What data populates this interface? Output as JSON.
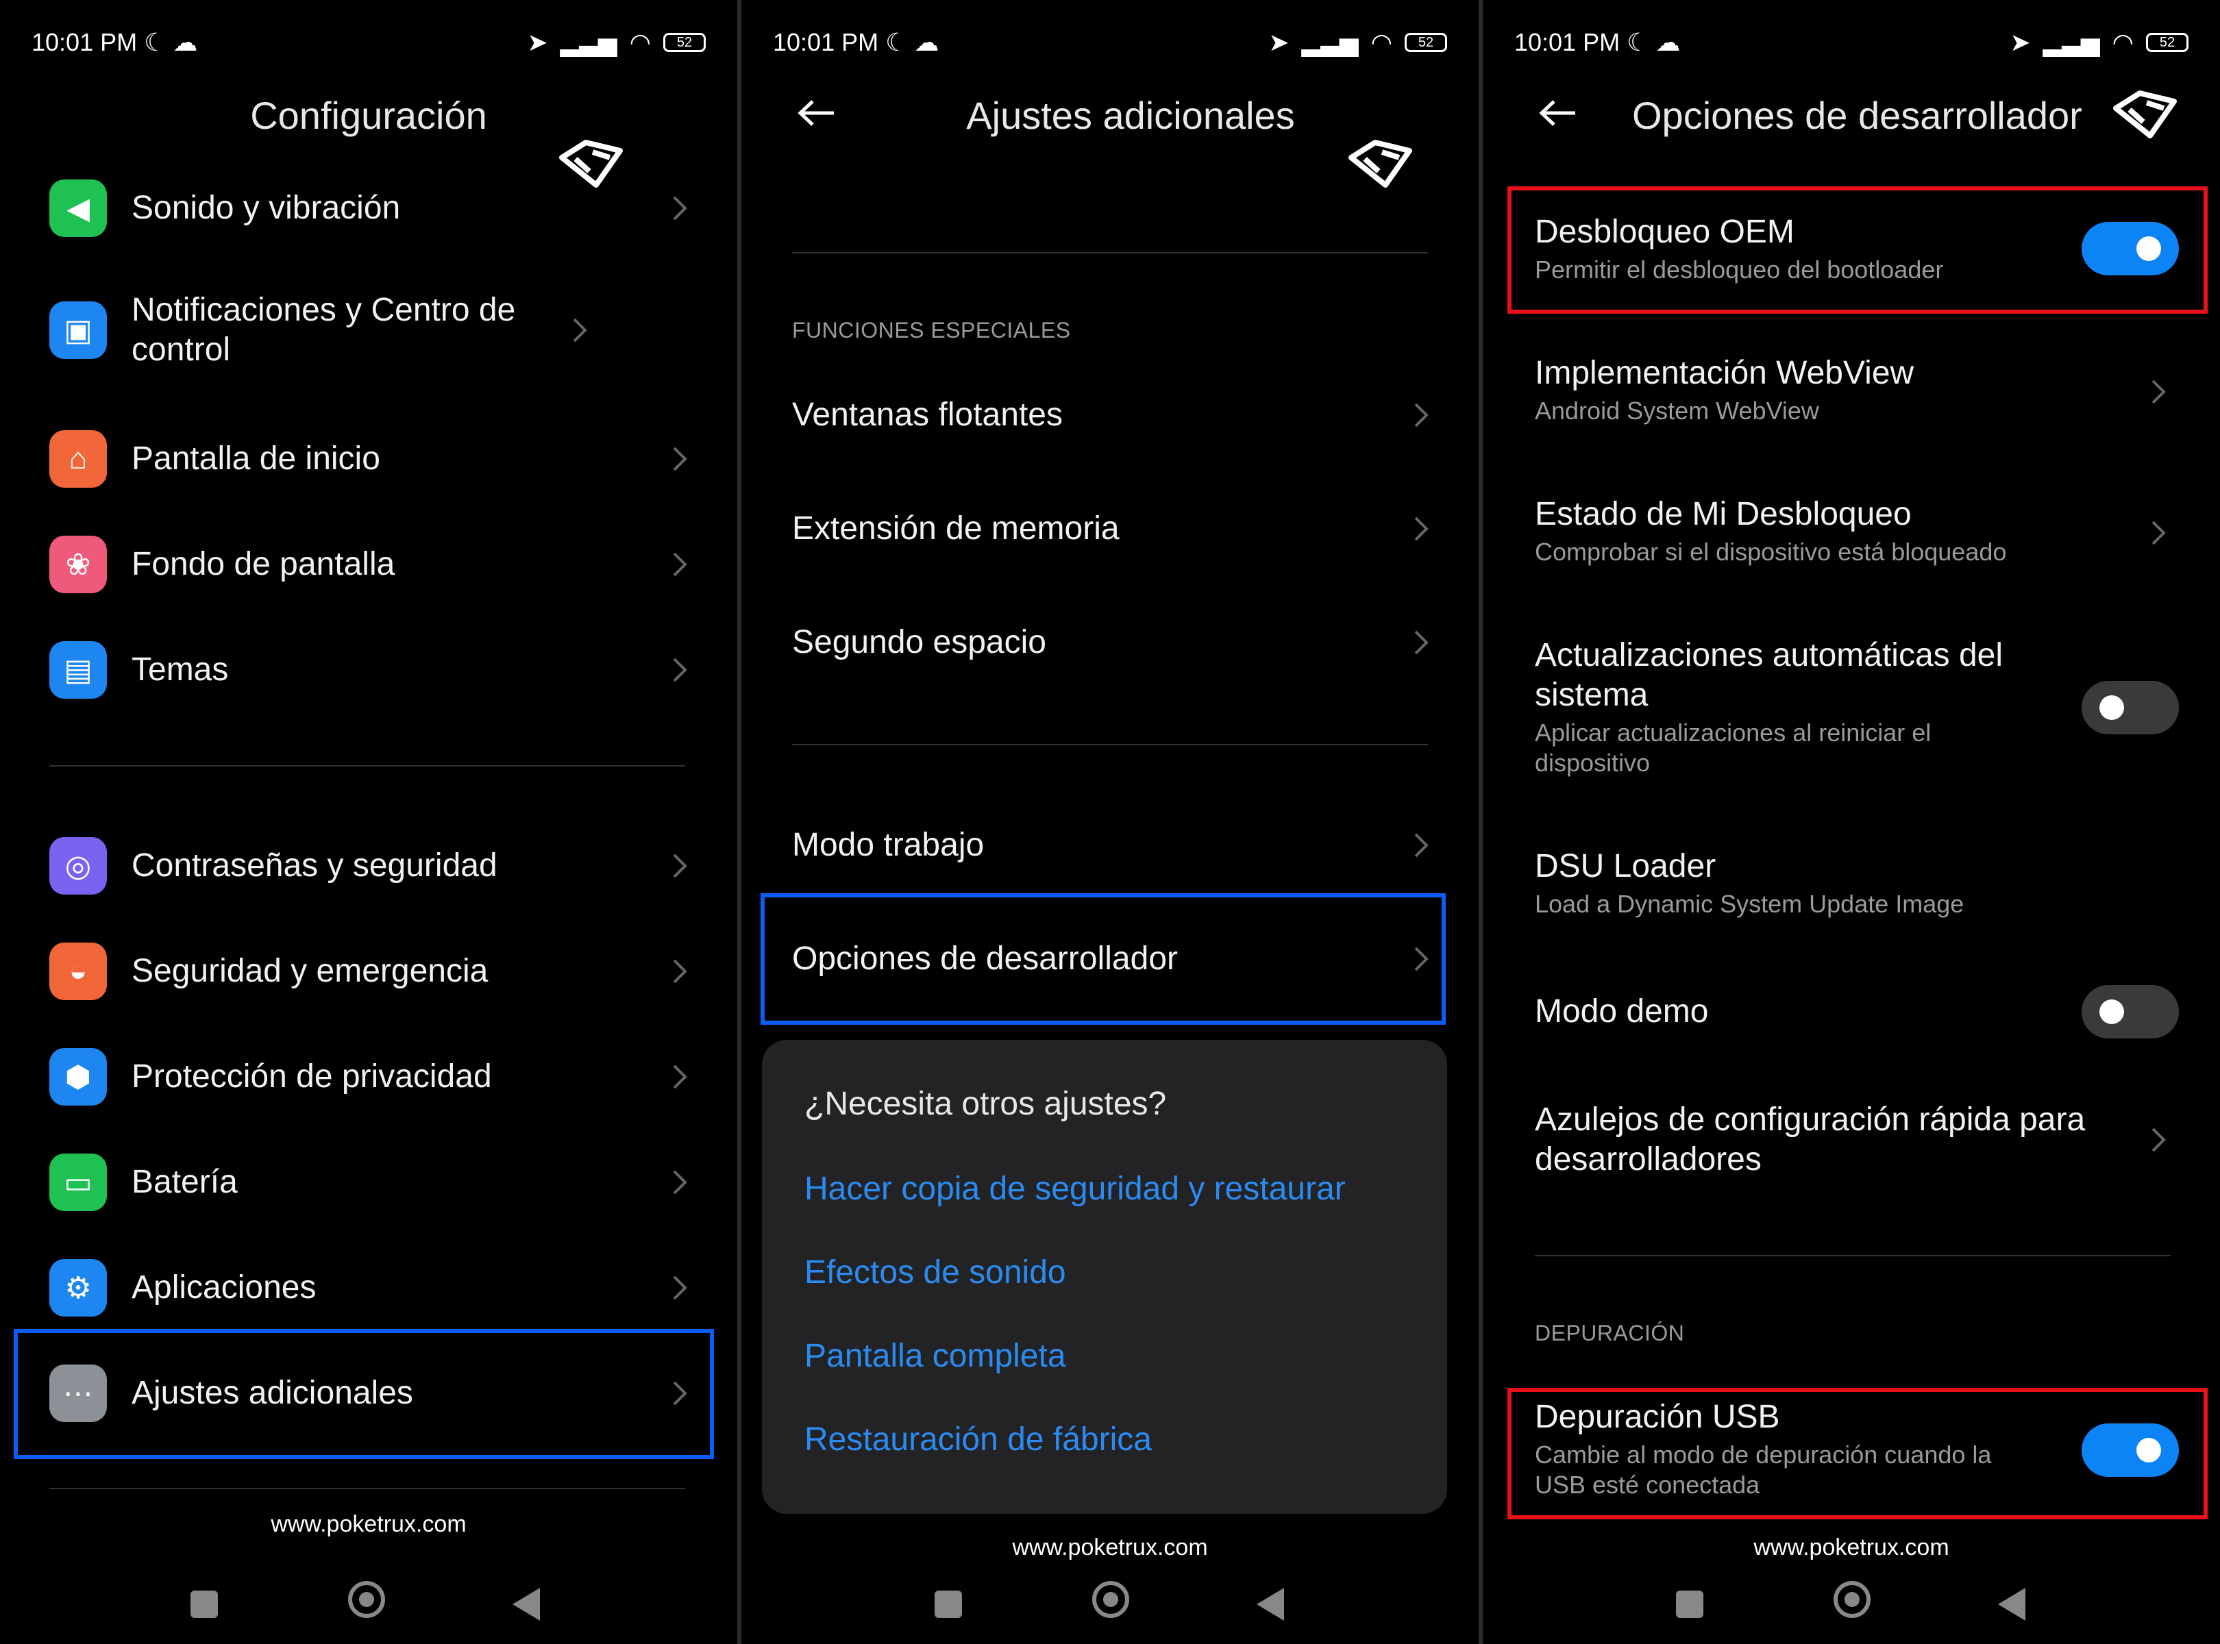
{
  "status": {
    "time": "10:01 PM",
    "battery": "52"
  },
  "panel1": {
    "title": "Configuración",
    "items": [
      {
        "label": "Sonido y vibración",
        "icon": "speaker-icon",
        "color": "#1fc153"
      },
      {
        "label": "Notificaciones y Centro de control",
        "icon": "notification-icon",
        "color": "#1e86f0"
      },
      {
        "label": "Pantalla de inicio",
        "icon": "home-icon",
        "color": "#f2673a"
      },
      {
        "label": "Fondo de pantalla",
        "icon": "flower-icon",
        "color": "#f05a7a"
      },
      {
        "label": "Temas",
        "icon": "brush-icon",
        "color": "#1e86f0"
      },
      {
        "label": "Contraseñas y seguridad",
        "icon": "fingerprint-icon",
        "color": "#7b62f0"
      },
      {
        "label": "Seguridad y emergencia",
        "icon": "bell-icon",
        "color": "#f2673a"
      },
      {
        "label": "Protección de privacidad",
        "icon": "shield-icon",
        "color": "#1e86f0"
      },
      {
        "label": "Batería",
        "icon": "battery-icon",
        "color": "#1fc153"
      },
      {
        "label": "Aplicaciones",
        "icon": "gear-icon",
        "color": "#1e86f0"
      },
      {
        "label": "Ajustes adicionales",
        "icon": "more-icon",
        "color": "#8c9097"
      }
    ],
    "footer": "www.poketrux.com"
  },
  "panel2": {
    "title": "Ajustes adicionales",
    "section": "FUNCIONES ESPECIALES",
    "items": [
      "Ventanas flotantes",
      "Extensión de memoria",
      "Segundo espacio",
      "Modo trabajo",
      "Opciones de desarrollador"
    ],
    "card": {
      "question": "¿Necesita otros ajustes?",
      "links": [
        "Hacer copia de seguridad y restaurar",
        "Efectos de sonido",
        "Pantalla completa",
        "Restauración de fábrica"
      ]
    },
    "footer": "www.poketrux.com"
  },
  "panel3": {
    "title": "Opciones de desarrollador",
    "items": [
      {
        "title": "Desbloqueo OEM",
        "subtitle": "Permitir el desbloqueo del bootloader",
        "toggle": "on"
      },
      {
        "title": "Implementación WebView",
        "subtitle": "Android System WebView"
      },
      {
        "title": "Estado de Mi Desbloqueo",
        "subtitle": "Comprobar si el dispositivo está bloqueado"
      },
      {
        "title": "Actualizaciones automáticas del sistema",
        "subtitle": "Aplicar actualizaciones al reiniciar el dispositivo",
        "toggle": "off"
      },
      {
        "title": "DSU Loader",
        "subtitle": "Load a Dynamic System Update Image"
      },
      {
        "title": "Modo demo",
        "toggle": "off"
      },
      {
        "title": "Azulejos de configuración rápida para desarrolladores"
      }
    ],
    "section": "DEPURACIÓN",
    "usb": {
      "title": "Depuración USB",
      "subtitle": "Cambie al modo de depuración cuando la USB esté conectada",
      "toggle": "on"
    },
    "footer": "www.poketrux.com"
  },
  "colors": {
    "accent": "#0d84f5",
    "link": "#2a8cf2",
    "highlight_blue": "#0a5df5",
    "highlight_red": "#e8101a"
  }
}
